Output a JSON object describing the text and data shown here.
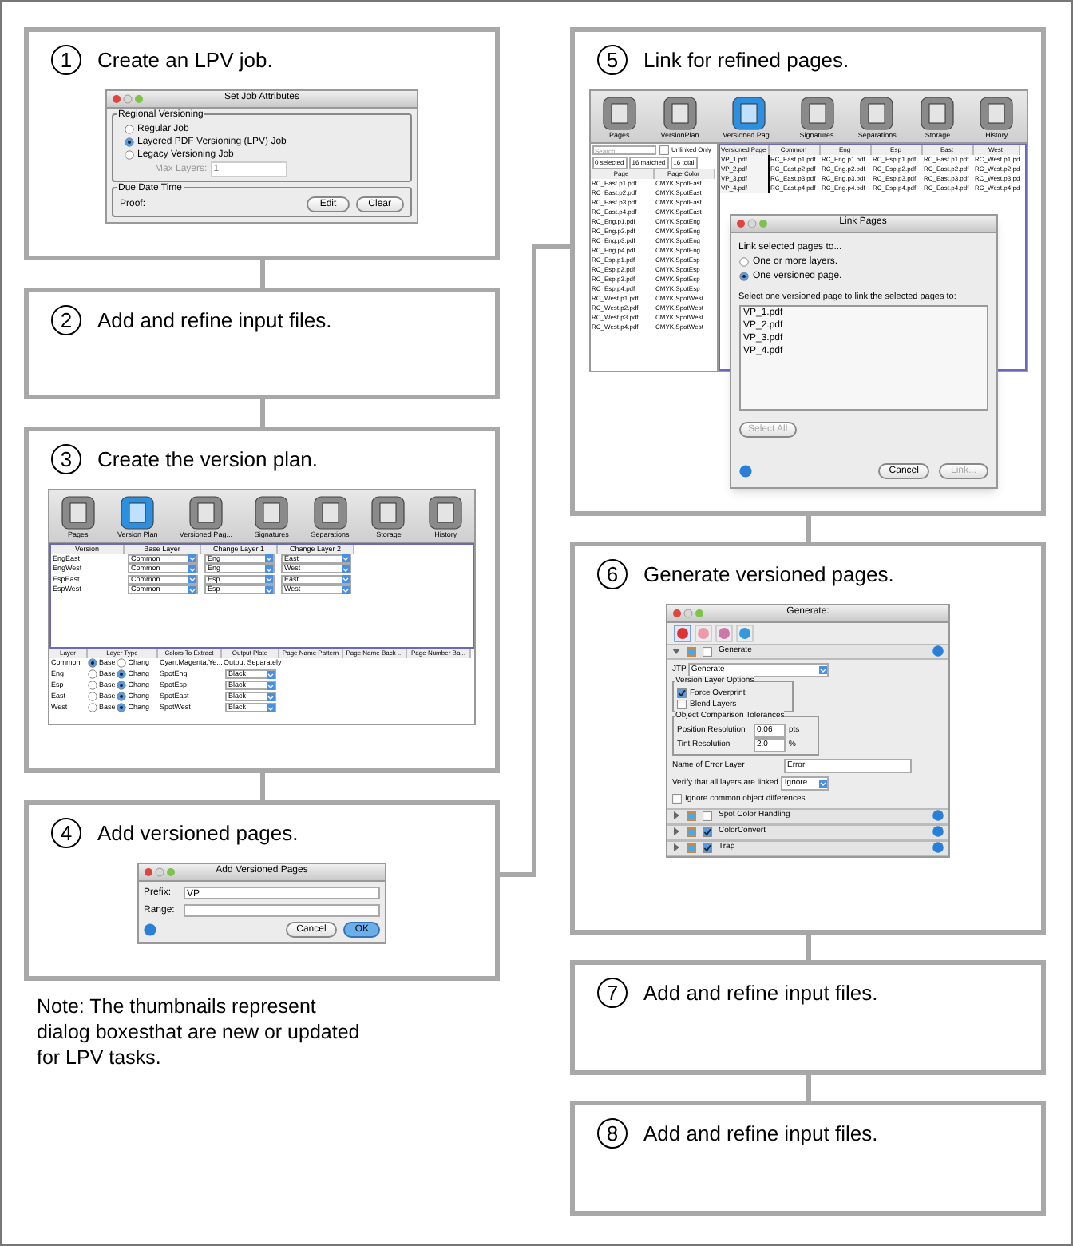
{
  "left_column": {
    "steps": [
      {
        "number": "1",
        "title": "Create an LPV job.",
        "thumbnail": {
          "kind": "job_attributes",
          "title": "Set Job Attributes",
          "group": "Regional Versioning",
          "options": [
            {
              "label": "Regular Job",
              "selected": false
            },
            {
              "label": "Layered PDF Versioning (LPV) Job",
              "selected": true
            },
            {
              "label": "Legacy Versioning Job",
              "selected": false
            }
          ],
          "max_layers": {
            "label": "Max Layers:",
            "value": "1",
            "disabled": true
          },
          "group_2": "Due Date Time",
          "proof_label": "Proof:",
          "buttons": [
            "Edit",
            "Clear"
          ]
        }
      },
      {
        "number": "2",
        "title": "Add and refine input files."
      },
      {
        "number": "3",
        "title": "Create the version plan.",
        "thumbnail": {
          "kind": "version_plan",
          "toolbar": [
            {
              "label": "Pages",
              "selected": false
            },
            {
              "label": "Version Plan",
              "selected": true
            },
            {
              "label": "Versioned Pag...",
              "selected": false
            },
            {
              "label": "Signatures",
              "selected": false
            },
            {
              "label": "Separations",
              "selected": false
            },
            {
              "label": "Storage",
              "selected": false
            },
            {
              "label": "History",
              "selected": false
            }
          ],
          "versions": {
            "columns": [
              "Version",
              "Base Layer",
              "Change Layer 1",
              "Change Layer 2"
            ],
            "rows": [
              [
                "EngEast",
                "Common",
                "Eng",
                "East"
              ],
              [
                "EngWest",
                "Common",
                "Eng",
                "West"
              ],
              [
                "EspEast",
                "Common",
                "Esp",
                "East"
              ],
              [
                "EspWest",
                "Common",
                "Esp",
                "West"
              ]
            ]
          },
          "layers": {
            "columns": [
              "Layer",
              "Layer Type",
              "Colors To Extract",
              "Output Plate",
              "Page Name Pattern",
              "Page Name Back ...",
              "Page Number Ba..."
            ],
            "rows": [
              {
                "layer": "Common",
                "types": [
                  {
                    "label": "Base",
                    "selected": true
                  },
                  {
                    "label": "Chang",
                    "selected": false
                  }
                ],
                "colors": "Cyan,Magenta,Ye...",
                "output": "Output Separately",
                "kind": "text"
              },
              {
                "layer": "Eng",
                "types": [
                  {
                    "label": "Base",
                    "selected": false
                  },
                  {
                    "label": "Chang",
                    "selected": true
                  }
                ],
                "colors": "SpotEng",
                "output": "Black",
                "kind": "select"
              },
              {
                "layer": "Esp",
                "types": [
                  {
                    "label": "Base",
                    "selected": false
                  },
                  {
                    "label": "Chang",
                    "selected": true
                  }
                ],
                "colors": "SpotEsp",
                "output": "Black",
                "kind": "select"
              },
              {
                "layer": "East",
                "types": [
                  {
                    "label": "Base",
                    "selected": false
                  },
                  {
                    "label": "Chang",
                    "selected": true
                  }
                ],
                "colors": "SpotEast",
                "output": "Black",
                "kind": "select"
              },
              {
                "layer": "West",
                "types": [
                  {
                    "label": "Base",
                    "selected": false
                  },
                  {
                    "label": "Chang",
                    "selected": true
                  }
                ],
                "colors": "SpotWest",
                "output": "Black",
                "kind": "select"
              }
            ]
          }
        }
      },
      {
        "number": "4",
        "title": "Add versioned pages.",
        "thumbnail": {
          "kind": "add_versioned_pages",
          "title": "Add Versioned Pages",
          "fields": [
            {
              "label": "Prefix:",
              "value": "VP"
            },
            {
              "label": "Range:"
            }
          ],
          "buttons": [
            {
              "label": "Cancel",
              "default": false
            },
            {
              "label": "OK",
              "default": true
            }
          ]
        }
      }
    ],
    "note": "Note: The thumbnails represent dialog boxesthat are new or updated for LPV tasks."
  },
  "right_column": {
    "steps": [
      {
        "number": "5",
        "title": "Link for refined pages.",
        "thumbnail": {
          "kind": "link_pages",
          "toolbar": [
            {
              "label": "Pages",
              "selected": false
            },
            {
              "label": "VersionPlan",
              "selected": false
            },
            {
              "label": "Versioned Pag...",
              "selected": true
            },
            {
              "label": "Signatures",
              "selected": false
            },
            {
              "label": "Separations",
              "selected": false
            },
            {
              "label": "Storage",
              "selected": false
            },
            {
              "label": "History",
              "selected": false
            }
          ],
          "search_placeholder": "Search",
          "unlinked_only": {
            "label": "Unlinked Only",
            "checked": false
          },
          "counts": [
            "0 selected",
            "16 matched",
            "16 total"
          ],
          "pages": {
            "columns": [
              "Page",
              "Page Color"
            ],
            "rows": [
              [
                "RC_East.p1.pdf",
                "CMYK,SpotEast"
              ],
              [
                "RC_East.p2.pdf",
                "CMYK,SpotEast"
              ],
              [
                "RC_East.p3.pdf",
                "CMYK,SpotEast"
              ],
              [
                "RC_East.p4.pdf",
                "CMYK,SpotEast"
              ],
              [
                "RC_Eng.p1.pdf",
                "CMYK,SpotEng"
              ],
              [
                "RC_Eng.p2.pdf",
                "CMYK,SpotEng"
              ],
              [
                "RC_Eng.p3.pdf",
                "CMYK,SpotEng"
              ],
              [
                "RC_Eng.p4.pdf",
                "CMYK,SpotEng"
              ],
              [
                "RC_Esp.p1.pdf",
                "CMYK,SpotEsp"
              ],
              [
                "RC_Esp.p2.pdf",
                "CMYK,SpotEsp"
              ],
              [
                "RC_Esp.p3.pdf",
                "CMYK,SpotEsp"
              ],
              [
                "RC_Esp.p4.pdf",
                "CMYK,SpotEsp"
              ],
              [
                "RC_West.p1.pdf",
                "CMYK,SpotWest"
              ],
              [
                "RC_West.p2.pdf",
                "CMYK,SpotWest"
              ],
              [
                "RC_West.p3.pdf",
                "CMYK,SpotWest"
              ],
              [
                "RC_West.p4.pdf",
                "CMYK,SpotWest"
              ]
            ]
          },
          "versioned": {
            "columns": [
              "Versioned Page",
              "Common",
              "Eng",
              "Esp",
              "East",
              "West"
            ],
            "rows": [
              [
                "VP_1.pdf",
                "RC_East.p1.pdf",
                "RC_Eng.p1.pdf",
                "RC_Esp.p1.pdf",
                "RC_East.p1.pdf",
                "RC_West.p1.pd"
              ],
              [
                "VP_2.pdf",
                "RC_East.p2.pdf",
                "RC_Eng.p2.pdf",
                "RC_Esp.p2.pdf",
                "RC_East.p2.pdf",
                "RC_West.p2.pd"
              ],
              [
                "VP_3.pdf",
                "RC_East.p3.pdf",
                "RC_Eng.p3.pdf",
                "RC_Esp.p3.pdf",
                "RC_East.p3.pdf",
                "RC_West.p3.pd"
              ],
              [
                "VP_4.pdf",
                "RC_East.p4.pdf",
                "RC_Eng.p4.pdf",
                "RC_Esp.p4.pdf",
                "RC_East.p4.pdf",
                "RC_West.p4.pd"
              ]
            ]
          },
          "dialog": {
            "title": "Link Pages",
            "prompt": "Link selected pages to...",
            "options": [
              {
                "label": "One or more layers.",
                "selected": false
              },
              {
                "label": "One versioned page.",
                "selected": true
              }
            ],
            "list_label": "Select one versioned page to link the selected pages to:",
            "items": [
              "VP_1.pdf",
              "VP_2.pdf",
              "VP_3.pdf",
              "VP_4.pdf"
            ],
            "select_all": {
              "label": "Select All",
              "disabled": true
            },
            "buttons": [
              {
                "label": "Cancel",
                "disabled": false
              },
              {
                "label": "Link...",
                "disabled": true
              }
            ]
          }
        }
      },
      {
        "number": "6",
        "title": "Generate versioned pages.",
        "thumbnail": {
          "kind": "generate",
          "title": "Generate:",
          "tabs": [
            {
              "selected": true
            },
            {
              "selected": false
            },
            {
              "selected": false
            },
            {
              "selected": false
            }
          ],
          "sections": [
            {
              "title": "Generate",
              "expanded": true,
              "checked": false
            },
            {
              "title": "Spot Color Handling",
              "expanded": false,
              "checked": false
            },
            {
              "title": "ColorConvert",
              "expanded": false,
              "checked": true
            },
            {
              "title": "Trap",
              "expanded": false,
              "checked": true
            }
          ],
          "jtp": {
            "label": "JTP",
            "value": "Generate"
          },
          "layer_options": {
            "title": "Version Layer Options",
            "checks": [
              {
                "label": "Force Overprint",
                "checked": true
              },
              {
                "label": "Blend Layers",
                "checked": false
              }
            ]
          },
          "tolerances": {
            "title": "Object Comparison Tolerances",
            "rows": [
              {
                "label": "Position Resolution",
                "value": "0.06",
                "unit": "pts"
              },
              {
                "label": "Tint Resolution",
                "value": "2.0",
                "unit": "%"
              }
            ]
          },
          "error_layer": {
            "label": "Name of Error Layer",
            "value": "Error"
          },
          "verify": {
            "label": "Verify that all layers are linked",
            "value": "Ignore"
          },
          "ignore_common": {
            "label": "Ignore common object differences",
            "checked": false
          }
        }
      },
      {
        "number": "7",
        "title": "Add and refine input files."
      },
      {
        "number": "8",
        "title": "Add and refine input files."
      }
    ]
  }
}
